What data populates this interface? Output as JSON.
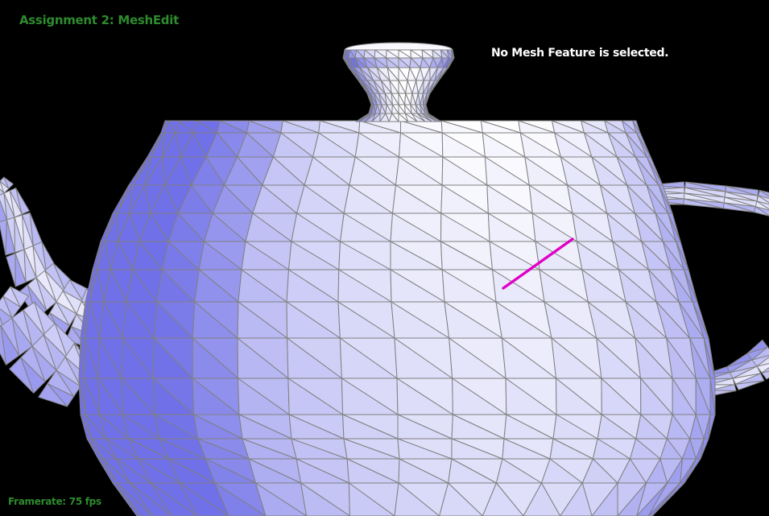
{
  "app": {
    "title": "Assignment 2: MeshEdit"
  },
  "status": {
    "selection_text": "No Mesh Feature is selected."
  },
  "framerate": {
    "label": "Framerate:",
    "value": "75 fps"
  },
  "colors": {
    "background": "#000000",
    "title_text": "#2e8b2e",
    "status_text": "#ffffff",
    "mesh_light": "#ffffff",
    "mesh_dark": "#7070e8",
    "wireframe": "#808080",
    "selected_edge": "#e000c8"
  },
  "scene": {
    "model": "teapot",
    "render_mode": "shaded-with-wireframe",
    "hovered_element": "edge"
  }
}
